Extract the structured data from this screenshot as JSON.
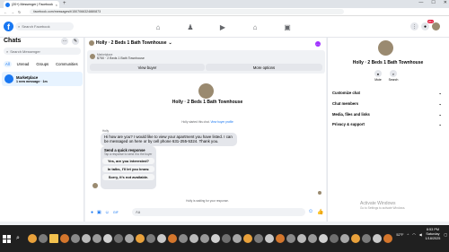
{
  "browser": {
    "tab_title": "(20+) Messenger | Facebook",
    "new_tab": "+",
    "url": "facebook.com/messages/t/1507066324880873",
    "window_controls": [
      "—",
      "☐",
      "✕"
    ]
  },
  "header": {
    "logo": "f",
    "search_placeholder": "Search Facebook",
    "notification_count": "20+"
  },
  "sidebar": {
    "title": "Chats",
    "search_placeholder": "Search Messenger",
    "filters": [
      "All",
      "Unread",
      "Groups",
      "Communities"
    ],
    "conversation": {
      "name": "Marketplace",
      "preview": "1 new message · 1m"
    }
  },
  "thread": {
    "title": "Holly · 2 Beds 1 Bath Townhouse",
    "listing_label": "Marketplace",
    "listing_line": "$750 · 2 Beds 1 Bath Townhouse",
    "view_buyer": "View buyer",
    "more_options": "More options",
    "contact_name": "Holly · 2 Beds 1 Bath Townhouse",
    "started_text": "Holly started this chat.",
    "view_profile": "View buyer profile",
    "sender": "Holly",
    "message": "Hi how are you? I would like to view your apartment you have listed. I can be messaged on here or by cell phone 631-255-5324. Thank you.",
    "quick_title": "Send a quick response",
    "quick_sub": "Tap a response to send it to the buyer",
    "quick_replies": [
      "Yes, are you interested?",
      "In talks, I'll let you know.",
      "Sorry, it's not available."
    ],
    "waiting": "Holly is waiting for your response.",
    "composer_placeholder": "Aa"
  },
  "details": {
    "name": "Holly · 2 Beds 1 Bath Townhouse",
    "actions": [
      "Mute",
      "Search"
    ],
    "sections": [
      "Customize chat",
      "Chat members",
      "Media, files and links",
      "Privacy & support"
    ],
    "watermark_title": "Activate Windows",
    "watermark_sub": "Go to Settings to activate Windows."
  },
  "taskbar": {
    "weather": "52°F",
    "time": "8:53 PM",
    "day": "Saturday",
    "date": "1/18/2025"
  },
  "colors": {
    "accent": "#1877f2",
    "purple": "#a033ff",
    "badge": "#e41e3f"
  }
}
